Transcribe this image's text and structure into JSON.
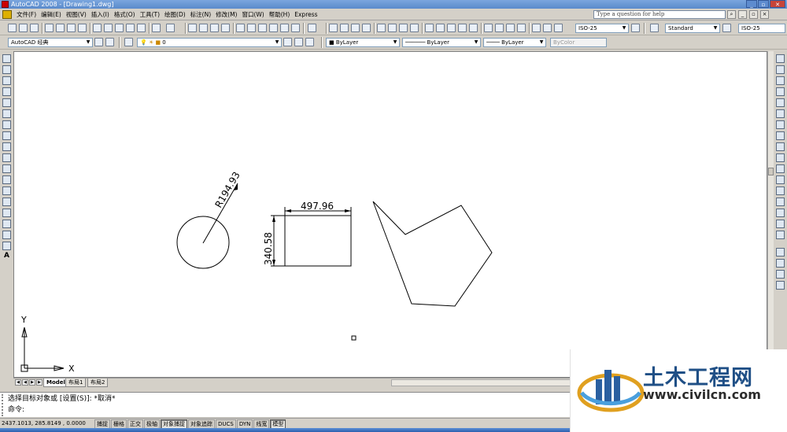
{
  "window": {
    "title": "AutoCAD 2008 - [Drawing1.dwg]",
    "controls": [
      "_",
      "▫",
      "✕"
    ]
  },
  "menubar": {
    "items": [
      "文件(F)",
      "编辑(E)",
      "视图(V)",
      "插入(I)",
      "格式(O)",
      "工具(T)",
      "绘图(D)",
      "标注(N)",
      "修改(M)",
      "窗口(W)",
      "帮助(H)",
      "Express"
    ],
    "help_placeholder": "Type a question for help"
  },
  "toolbar_top": {
    "dimstyle": "ISO-25",
    "textstyle": "Standard",
    "dimstyle2": "ISO-25"
  },
  "toolbar_properties": {
    "workspace": "AutoCAD 经典",
    "layer": "0",
    "color": "ByLayer",
    "linetype": "ByLayer",
    "lineweight": "ByLayer",
    "plotstyle": "ByColor"
  },
  "drawing": {
    "radius_dim": "R194.93",
    "width_dim": "497.96",
    "height_dim": "340.58",
    "ucs_x": "X",
    "ucs_y": "Y"
  },
  "layout_tabs": [
    "Model",
    "布局1",
    "布局2"
  ],
  "command": {
    "line1": "选择目标对象或 [设置(S)]: *取消*",
    "line2": "命令:"
  },
  "status": {
    "coords": "2437.1013, 285.8149 , 0.0000",
    "buttons": [
      "捕捉",
      "栅格",
      "正交",
      "极轴",
      "对象捕捉",
      "对象追踪",
      "DUCS",
      "DYN",
      "线宽",
      "模型"
    ],
    "active": [
      "对象捕捉",
      "模型"
    ]
  },
  "watermark": {
    "name": "土木工程网",
    "url": "www.civilcn.com"
  },
  "colors": {
    "title_bar": "#5a8acb",
    "canvas": "#ffffff",
    "watermark_blue": "#1f4f86"
  }
}
